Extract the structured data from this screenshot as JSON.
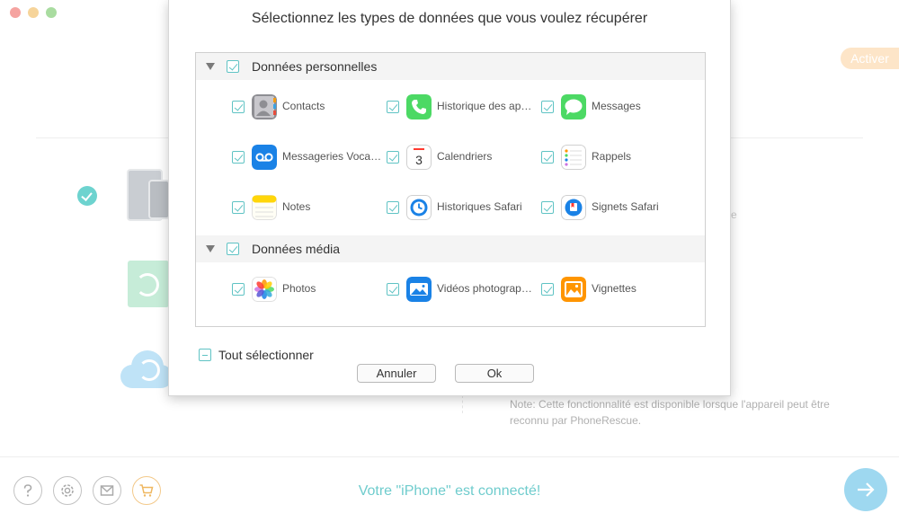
{
  "window": {
    "activate_label": "Activer"
  },
  "background": {
    "faint_fragment": "e",
    "note": "Note: Cette fonctionnalité est disponible lorsque l'appareil peut être reconnu par PhoneRescue."
  },
  "footer": {
    "status": "Votre \"iPhone\" est connecté!",
    "icons": [
      "help-icon",
      "settings-icon",
      "mail-icon",
      "cart-icon",
      "arrow-right-icon"
    ]
  },
  "dialog": {
    "title": "Sélectionnez les types de données que vous voulez récupérer",
    "sections": [
      {
        "label": "Données personnelles",
        "checked": true,
        "items": [
          {
            "label": "Contacts",
            "icon": "contacts-icon",
            "checked": true
          },
          {
            "label": "Historique des appels",
            "icon": "phone-icon",
            "checked": true
          },
          {
            "label": "Messages",
            "icon": "messages-icon",
            "checked": true
          },
          {
            "label": "Messageries Vocales",
            "icon": "voicemail-icon",
            "checked": true
          },
          {
            "label": "Calendriers",
            "icon": "calendar-icon",
            "checked": true,
            "calendar_day": "3"
          },
          {
            "label": "Rappels",
            "icon": "reminders-icon",
            "checked": true
          },
          {
            "label": "Notes",
            "icon": "notes-icon",
            "checked": true
          },
          {
            "label": "Historiques Safari",
            "icon": "safari-history-icon",
            "checked": true
          },
          {
            "label": "Signets Safari",
            "icon": "safari-bookmarks-icon",
            "checked": true
          }
        ]
      },
      {
        "label": "Données média",
        "checked": true,
        "items": [
          {
            "label": "Photos",
            "icon": "photos-icon",
            "checked": true
          },
          {
            "label": "Vidéos photographiques",
            "icon": "photo-videos-icon",
            "checked": true
          },
          {
            "label": "Vignettes",
            "icon": "thumbnails-icon",
            "checked": true
          }
        ]
      }
    ],
    "select_all_label": "Tout sélectionner",
    "cancel_label": "Annuler",
    "ok_label": "Ok"
  },
  "colors": {
    "accent": "#5fc3c4",
    "status_text": "#6fcccd",
    "activate_bg": "#fde5c8"
  }
}
